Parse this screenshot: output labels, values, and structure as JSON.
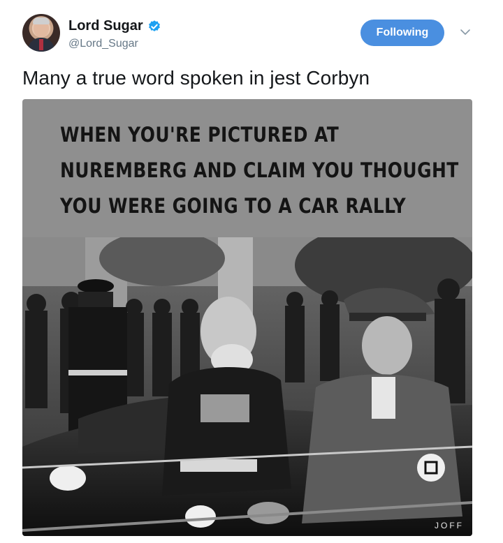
{
  "tweet": {
    "author_name": "Lord Sugar",
    "author_handle": "@Lord_Sugar",
    "follow_label": "Following",
    "text": "Many a true word spoken in jest Corbyn"
  },
  "media": {
    "caption_lines": [
      "WHEN YOU'RE PICTURED AT",
      "NUREMBERG AND CLAIM YOU THOUGHT",
      "YOU WERE GOING TO A CAR RALLY"
    ],
    "watermark": "JOFF"
  },
  "icons": {
    "verified": "verified-badge-icon",
    "caret": "chevron-down-icon"
  },
  "colors": {
    "follow_button": "#4a8fe0",
    "verified_badge": "#1da1f2",
    "handle_text": "#657786",
    "caption_bg": "#8f8f8f"
  }
}
